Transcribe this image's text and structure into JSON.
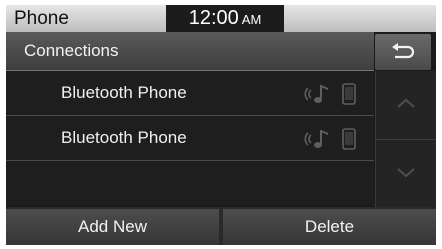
{
  "status_bar": {
    "app_title": "Phone",
    "time": "12:00",
    "am_pm": "AM"
  },
  "header": {
    "title": "Connections",
    "back_icon": "back-return-icon"
  },
  "devices": [
    {
      "label": "Bluetooth Phone",
      "icons": [
        "audio-streaming-icon",
        "phone-icon"
      ]
    },
    {
      "label": "Bluetooth Phone",
      "icons": [
        "audio-streaming-icon",
        "phone-icon"
      ]
    }
  ],
  "scroll": {
    "up_icon": "chevron-up-icon",
    "down_icon": "chevron-down-icon"
  },
  "bottom": {
    "add_new_label": "Add New",
    "delete_label": "Delete"
  },
  "colors": {
    "background": "#1a1a1a",
    "statusbar": "#d0d0d0",
    "text": "#f0f0f0",
    "icon_dim": "#5a5a5a"
  }
}
